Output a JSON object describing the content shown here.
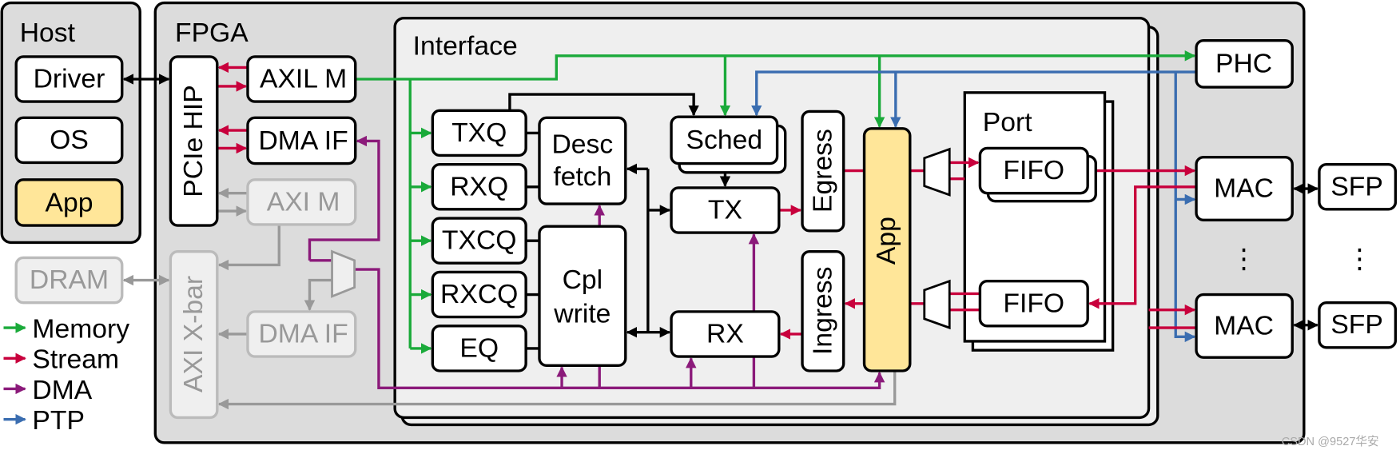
{
  "colors": {
    "memory": "#1aaa3a",
    "stream": "#c8003c",
    "dma": "#8b1a7a",
    "ptp": "#3a6db0",
    "disabled": "#999999",
    "app": "#ffe699"
  },
  "host": {
    "title": "Host",
    "driver": "Driver",
    "os": "OS",
    "app": "App"
  },
  "dram": "DRAM",
  "fpga": {
    "title": "FPGA",
    "pcie_hip": "PCIe HIP",
    "axil_m": "AXIL M",
    "dma_if": "DMA IF",
    "axi_m": "AXI M",
    "dma_if_2": "DMA IF",
    "axi_xbar": "AXI X-bar",
    "phc": "PHC"
  },
  "interface": {
    "title": "Interface",
    "txq": "TXQ",
    "rxq": "RXQ",
    "txcq": "TXCQ",
    "rxcq": "RXCQ",
    "eq": "EQ",
    "desc_fetch": [
      "Desc",
      "fetch"
    ],
    "cpl_write": [
      "Cpl",
      "write"
    ],
    "sched": "Sched",
    "tx": "TX",
    "rx": "RX",
    "egress": "Egress",
    "ingress": "Ingress",
    "app": "App"
  },
  "port": {
    "title": "Port",
    "fifo_tx": "FIFO",
    "fifo_rx": "FIFO"
  },
  "macs": [
    {
      "mac": "MAC",
      "sfp": "SFP"
    },
    {
      "mac": "MAC",
      "sfp": "SFP"
    }
  ],
  "ellipsis": "⋮",
  "legend": [
    {
      "label": "Memory",
      "color": "#1aaa3a"
    },
    {
      "label": "Stream",
      "color": "#c8003c"
    },
    {
      "label": "DMA",
      "color": "#8b1a7a"
    },
    {
      "label": "PTP",
      "color": "#3a6db0"
    }
  ],
  "watermark": "CSDN @9527华安"
}
